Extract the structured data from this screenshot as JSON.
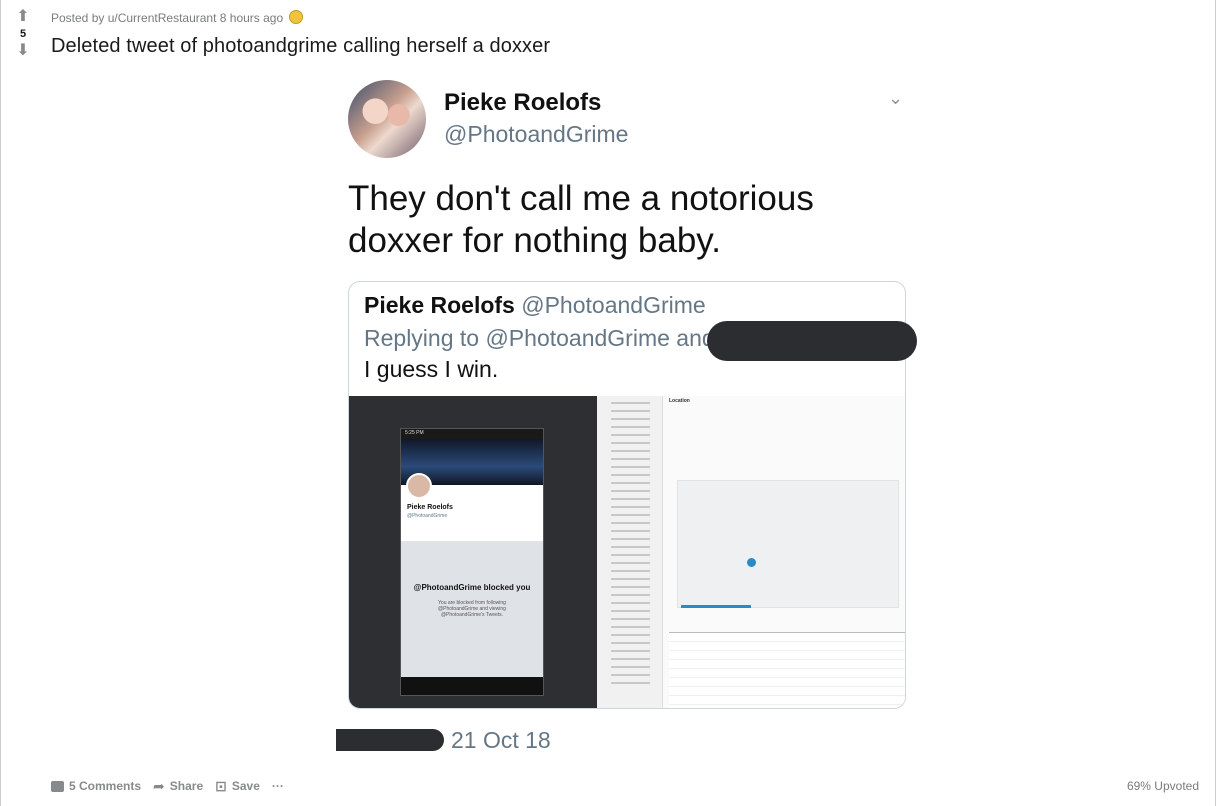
{
  "post": {
    "score": "5",
    "posted_by": "Posted by u/CurrentRestaurant 8 hours ago",
    "award_icon": "award-icon",
    "title": "Deleted tweet of photoandgrime calling herself a doxxer",
    "upvoted": "69% Upvoted"
  },
  "tweet": {
    "name": "Pieke Roelofs",
    "handle": "@PhotoandGrime",
    "text": "They don't call me a notorious doxxer for nothing baby.",
    "date": "21 Oct 18",
    "quoted": {
      "name": "Pieke Roelofs",
      "handle": "@PhotoandGrime",
      "replying": "Replying to @PhotoandGrime and",
      "text": "I guess I win."
    },
    "screenshot": {
      "phone_name": "Pieke Roelofs",
      "phone_handle": "@PhotoandGrime",
      "blocked_title": "@PhotoandGrime blocked you",
      "blocked_body": "You are blocked from following @PhotoandGrime and viewing @PhotoandGrime's Tweets.",
      "status_time": "5:25 PM",
      "analytics_heading": "Location"
    }
  },
  "actions": {
    "comments": "5 Comments",
    "share": "Share",
    "save": "Save",
    "more": "···"
  },
  "colors": {
    "vote_gray": "#878a8c",
    "twitter_gray": "#657786",
    "redaction": "#2b2d30",
    "analytics_blue": "#2a8ac4"
  }
}
